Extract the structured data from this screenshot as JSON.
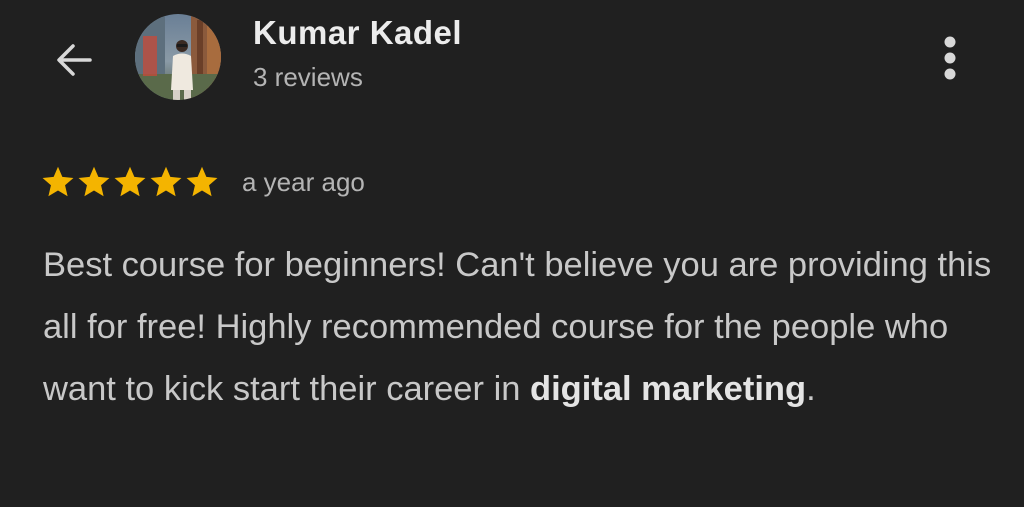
{
  "header": {
    "back_icon": "arrow-left-icon",
    "avatar_icon": "avatar-photo",
    "reviewer_name": "Kumar Kadel",
    "review_count": "3 reviews",
    "more_icon": "more-vertical-icon"
  },
  "review": {
    "rating": 5,
    "rating_max": 5,
    "star_color": "#f4b400",
    "date": "a year ago",
    "text_part1": "Best course for beginners! Can't believe you are providing this all for free! Highly recommended course for the people who want to kick start their career in ",
    "text_bold": "digital marketing",
    "text_part2": "."
  },
  "colors": {
    "background": "#202020",
    "name_text": "#ececec",
    "secondary_text": "#b4b4b4",
    "body_text": "#c8c8c8"
  }
}
